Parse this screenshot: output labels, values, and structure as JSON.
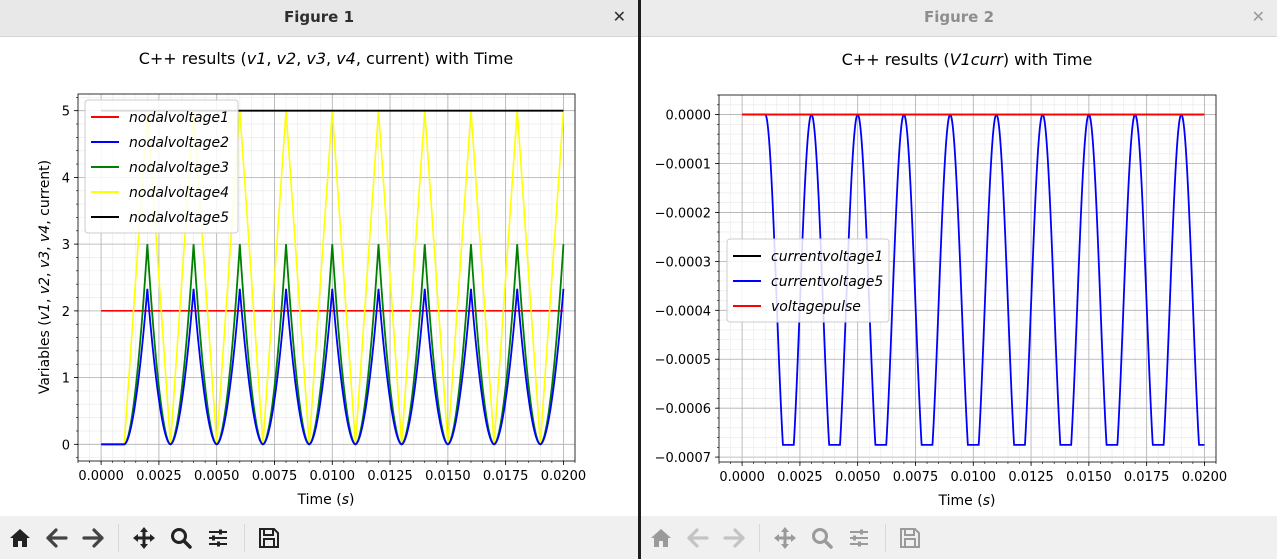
{
  "window1": {
    "title": "Figure 1",
    "close_icon": "close-icon"
  },
  "window2": {
    "title": "Figure 2",
    "close_icon": "close-icon"
  },
  "toolbar": {
    "buttons": [
      "home-icon",
      "back-icon",
      "forward-icon",
      "pan-icon",
      "zoom-icon",
      "configure-icon",
      "save-icon"
    ]
  },
  "chart_data": [
    {
      "type": "line",
      "title_prefix": "C++ results (",
      "title_vars": [
        "v1",
        "v2",
        "v3",
        "v4"
      ],
      "title_suffix": "current) with Time",
      "xlabel_prefix": "Time (",
      "xlabel_unit": "s",
      "ylabel_prefix": "Variables (",
      "ylabel_vars": [
        "v1",
        "v2",
        "v3",
        "v4"
      ],
      "ylabel_suffix": "current)",
      "xlim": [
        -0.001,
        0.0205
      ],
      "ylim": [
        -0.25,
        5.25
      ],
      "x_ticks": [
        "0.0000",
        "0.0025",
        "0.0050",
        "0.0075",
        "0.0100",
        "0.0125",
        "0.0150",
        "0.0175",
        "0.0200"
      ],
      "y_ticks": [
        "0",
        "1",
        "2",
        "3",
        "4",
        "5"
      ],
      "grid": true,
      "minor_grid": true,
      "legend_position": "upper-left",
      "series": [
        {
          "name": "nodalvoltage1",
          "color": "#ff0000",
          "description": "constant",
          "value": 2.0
        },
        {
          "name": "nodalvoltage2",
          "color": "#0000ff",
          "description": "periodic pulses, 0 to 1.0 ms then pulses of period 2 ms",
          "start": 0.001,
          "period": 0.002,
          "peak": 2.33
        },
        {
          "name": "nodalvoltage3",
          "color": "#008000",
          "description": "periodic pulses",
          "start": 0.001,
          "period": 0.002,
          "peak": 3.0
        },
        {
          "name": "nodalvoltage4",
          "color": "#ffff00",
          "description": "triangle wave 0 to 5",
          "start": 0.001,
          "period": 0.002,
          "peak": 5.0
        },
        {
          "name": "nodalvoltage5",
          "color": "#000000",
          "description": "constant",
          "value": 5.0
        }
      ]
    },
    {
      "type": "line",
      "title_prefix": "C++ results (",
      "title_var": "V1curr",
      "title_suffix": ") with Time",
      "xlabel_prefix": "Time (",
      "xlabel_unit": "s",
      "xlim": [
        -0.001,
        0.0205
      ],
      "ylim": [
        -0.00071,
        4e-05
      ],
      "x_ticks": [
        "0.0000",
        "0.0025",
        "0.0050",
        "0.0075",
        "0.0100",
        "0.0125",
        "0.0150",
        "0.0175",
        "0.0200"
      ],
      "y_ticks": [
        "0.0000",
        "−0.0001",
        "−0.0002",
        "−0.0003",
        "−0.0004",
        "−0.0005",
        "−0.0006",
        "−0.0007"
      ],
      "grid": true,
      "minor_grid": true,
      "legend_position": "center-left",
      "series": [
        {
          "name": "currentvoltage1",
          "color": "#000000",
          "value": 0.0
        },
        {
          "name": "currentvoltage5",
          "color": "#0000ff",
          "description": "periodic negative pulses",
          "start": 0.001,
          "period": 0.002,
          "min": -0.000675
        },
        {
          "name": "voltagepulse",
          "color": "#ff0000",
          "value": 0.0
        }
      ]
    }
  ]
}
